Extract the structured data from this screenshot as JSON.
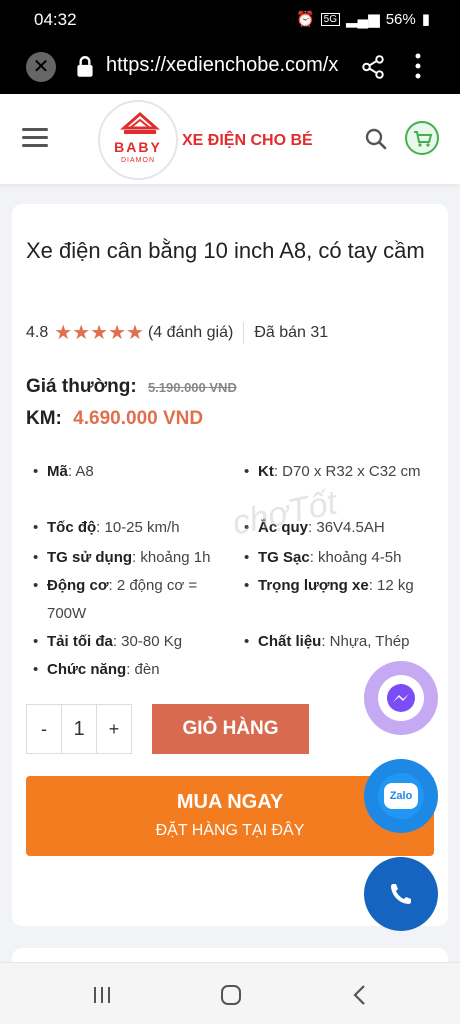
{
  "status_bar": {
    "time": "04:32",
    "battery": "56%",
    "network": "5G"
  },
  "browser": {
    "url": "https://xedienchobe.com/x"
  },
  "header": {
    "logo_top": "BABY",
    "logo_bottom": "DIAMON",
    "brand": "XE ĐIỆN CHO BÉ"
  },
  "product": {
    "title": "Xe điện cân bằng 10 inch A8, có tay cầm",
    "rating": "4.8",
    "stars": 5,
    "reviews": "(4 đánh giá)",
    "sold": "Đã bán 31",
    "regular_label": "Giá thường:",
    "regular_price": "5.190.000 VND",
    "sale_label": "KM:",
    "sale_price": "4.690.000 VND",
    "specs": [
      {
        "key": "Mã",
        "val": ": A8"
      },
      {
        "key": "Kt",
        "val": ": D70 x R32 x C32 cm"
      },
      {
        "key": "Tốc độ",
        "val": ": 10-25 km/h"
      },
      {
        "key": "Ắc quy",
        "val": ": 36V4.5AH"
      },
      {
        "key": "TG sử dụng",
        "val": ": khoảng 1h"
      },
      {
        "key": "TG Sạc",
        "val": ": khoảng 4-5h"
      },
      {
        "key": "Động cơ",
        "val": ": 2 động cơ = 700W"
      },
      {
        "key": "Trọng lượng xe",
        "val": ": 12 kg"
      },
      {
        "key": "Tải tối đa",
        "val": ": 30-80 Kg"
      },
      {
        "key": "Chất liệu",
        "val": ": Nhựa, Thép"
      },
      {
        "key": "Chức năng",
        "val": ": đèn"
      }
    ],
    "qty_minus": "-",
    "qty_value": "1",
    "qty_plus": "+",
    "add_to_cart": "GIỎ HÀNG",
    "buy_now": "MUA NGAY",
    "buy_now_sub": "ĐẶT HÀNG TẠI ĐÂY",
    "watermark": "chợTốt"
  },
  "floating": {
    "zalo_label": "Zalo"
  }
}
